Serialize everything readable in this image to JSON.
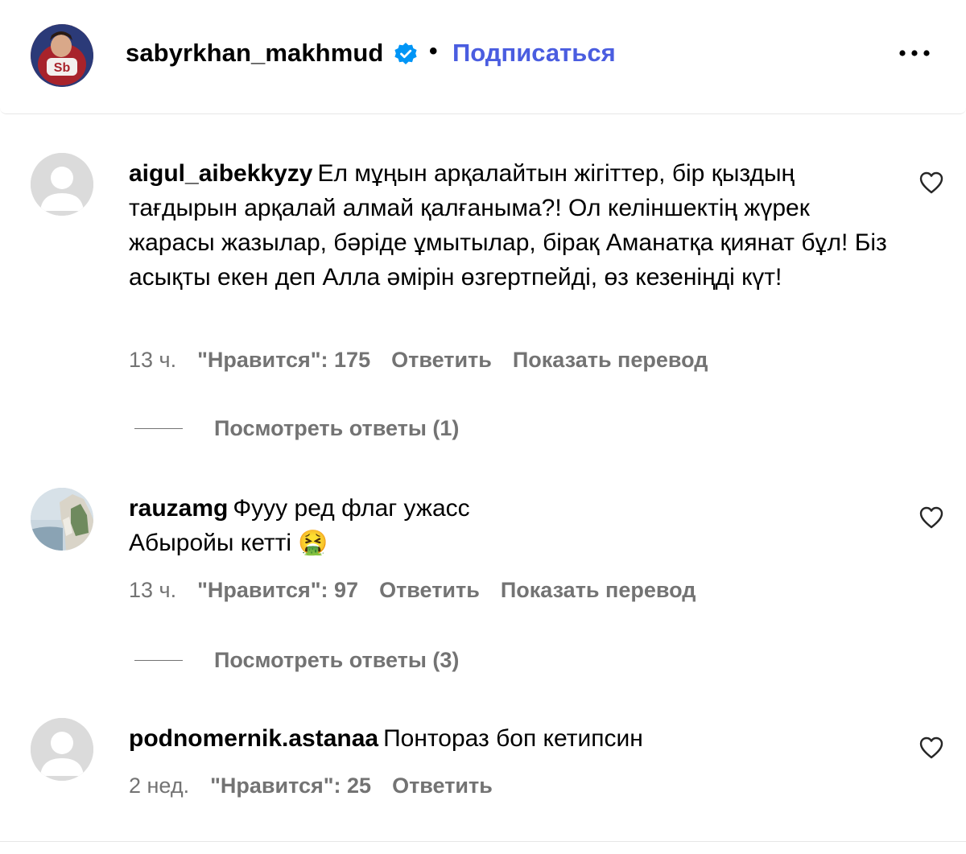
{
  "post": {
    "author": "sabyrkhan_makhmud",
    "verified": true,
    "separator": "•",
    "follow_label": "Подписаться",
    "more_icon": "more-horizontal-icon"
  },
  "comments": [
    {
      "username": "aigul_aibekkyzy",
      "text": "Ел мұңын арқалайтын жігіттер, бір қыздың тағдырын арқалай алмай қалғаныма?! Ол келіншектің жүрек жарасы жазылар, бәріде ұмытылар, бірақ Аманатқа қиянат бұл! Біз асықты екен деп Алла әмірін өзгертпейді, өз кезеніңді күт!",
      "time": "13 ч.",
      "likes": "\"Нравится\": 175",
      "reply_label": "Ответить",
      "translate_label": "Показать перевод",
      "view_replies": "Посмотреть ответы (1)",
      "avatar": "default-avatar"
    },
    {
      "username": "rauzamg",
      "text_line1": "Фууу ред флаг ужасс",
      "text_line2": "Абыройы кетті",
      "emoji": "🤮",
      "time": "13 ч.",
      "likes": "\"Нравится\": 97",
      "reply_label": "Ответить",
      "translate_label": "Показать перевод",
      "view_replies": "Посмотреть ответы (3)",
      "avatar": "cliff-photo-avatar"
    },
    {
      "username": "podnomernik.astanaa",
      "text": "Понтораз боп кетипсин",
      "time": "2 нед.",
      "likes": "\"Нравится\": 25",
      "reply_label": "Ответить",
      "avatar": "default-avatar"
    }
  ],
  "colors": {
    "link": "#4a5de0",
    "secondary_text": "#737373",
    "verified_badge": "#0095f6"
  }
}
